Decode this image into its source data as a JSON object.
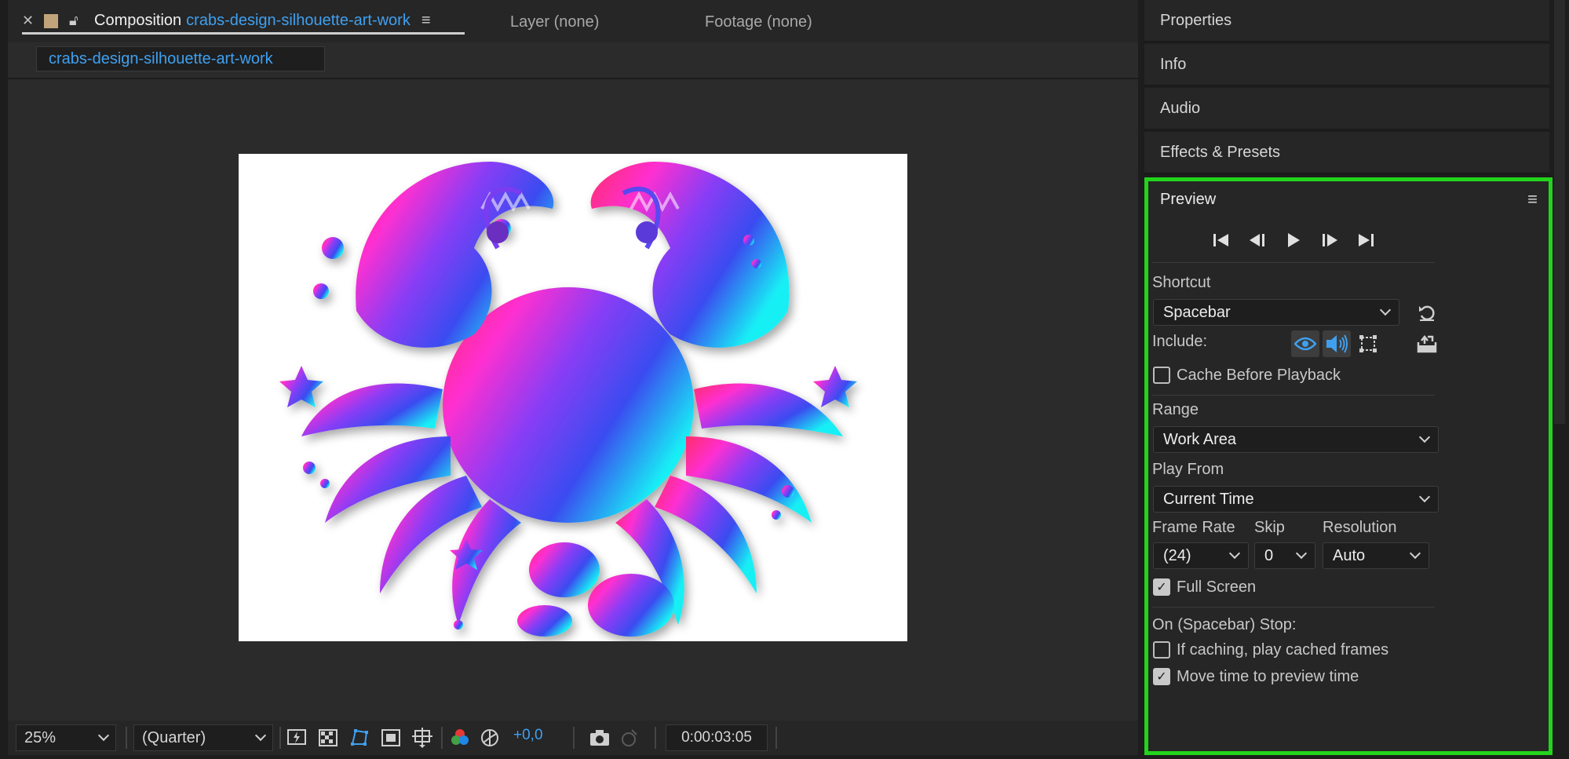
{
  "composition_panel": {
    "tab_label": "Composition",
    "comp_name": "crabs-design-silhouette-art-work",
    "layer_tab": "Layer (none)",
    "footage_tab": "Footage (none)",
    "subtab": "crabs-design-silhouette-art-work",
    "icons": {
      "close": "close-icon",
      "lock": "lock-icon",
      "menu": "menu-icon"
    }
  },
  "viewer_toolbar": {
    "zoom": "25%",
    "resolution": "(Quarter)",
    "exposure": "+0,0",
    "timecode": "0:00:03:05",
    "icons": [
      "fast-preview-icon",
      "transparency-grid-icon",
      "mask-path-icon",
      "region-of-interest-icon",
      "guides-icon",
      "color-channels-icon",
      "reset-exposure-icon",
      "snapshot-icon",
      "show-snapshot-icon"
    ]
  },
  "right_panels": {
    "properties": "Properties",
    "info": "Info",
    "audio": "Audio",
    "effects": "Effects & Presets"
  },
  "preview": {
    "title": "Preview",
    "shortcut_label": "Shortcut",
    "shortcut_value": "Spacebar",
    "include_label": "Include:",
    "cache_before_playback": "Cache Before Playback",
    "range_label": "Range",
    "range_value": "Work Area",
    "play_from_label": "Play From",
    "play_from_value": "Current Time",
    "frame_rate_label": "Frame Rate",
    "frame_rate_value": "(24)",
    "skip_label": "Skip",
    "skip_value": "0",
    "resolution_label": "Resolution",
    "resolution_value": "Auto",
    "full_screen": "Full Screen",
    "on_stop_label": "On (Spacebar) Stop:",
    "if_caching": "If caching, play cached frames",
    "move_time": "Move time to preview time",
    "checkboxes": {
      "cache_before_playback": false,
      "full_screen": true,
      "if_caching": false,
      "move_time": true
    },
    "highlight_color": "#22d41c",
    "accent_color": "#3fa0f0"
  }
}
